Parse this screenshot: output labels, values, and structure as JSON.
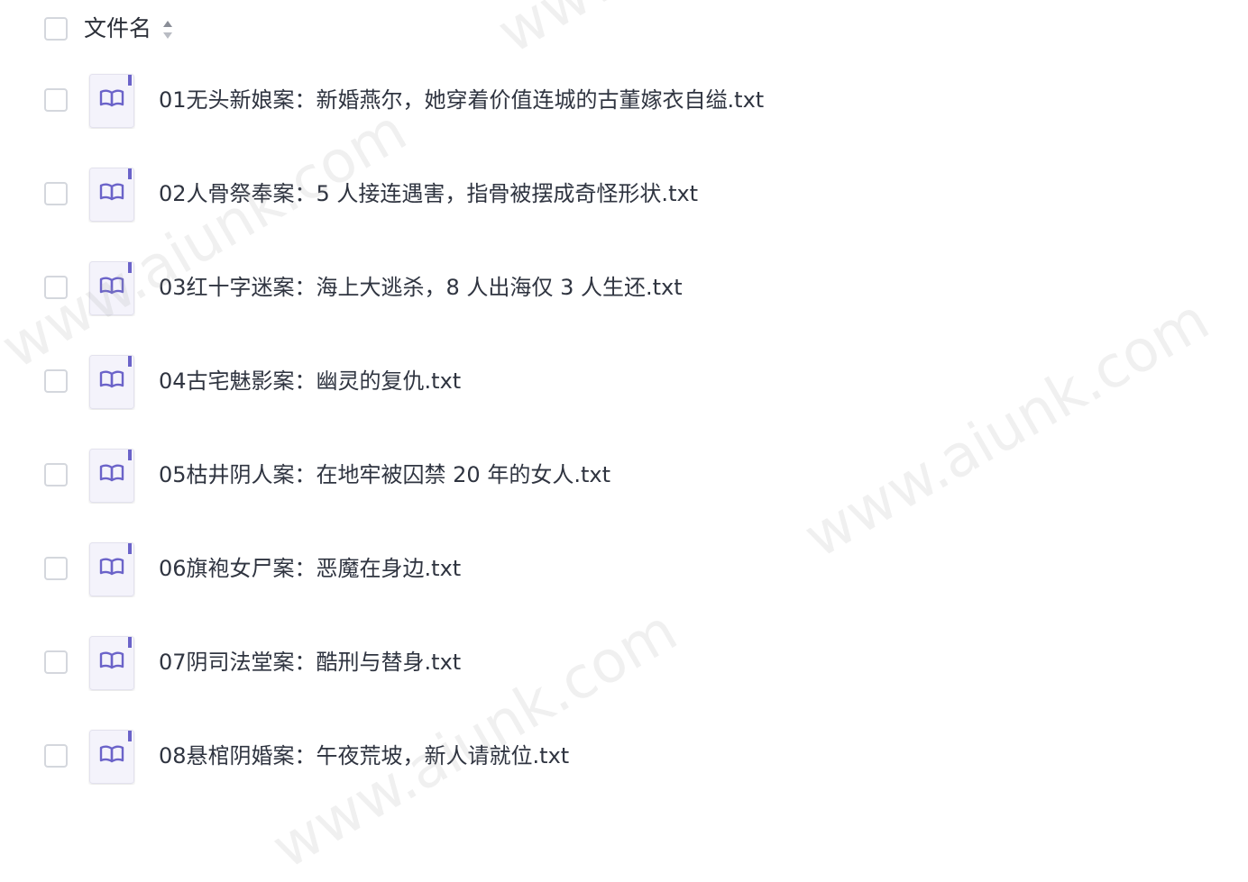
{
  "header": {
    "column_label": "文件名",
    "sort_icon": "sort-up-down-icon"
  },
  "file_icon": "book-icon",
  "files": [
    {
      "name": "01无头新娘案：新婚燕尔，她穿着价值连城的古董嫁衣自缢.txt"
    },
    {
      "name": "02人骨祭奉案：5 人接连遇害，指骨被摆成奇怪形状.txt"
    },
    {
      "name": "03红十字迷案：海上大逃杀，8 人出海仅 3 人生还.txt"
    },
    {
      "name": "04古宅魅影案：幽灵的复仇.txt"
    },
    {
      "name": "05枯井阴人案：在地牢被囚禁 20 年的女人.txt"
    },
    {
      "name": "06旗袍女尸案：恶魔在身边.txt"
    },
    {
      "name": "07阴司法堂案：酷刑与替身.txt"
    },
    {
      "name": "08悬棺阴婚案：午夜荒坡，新人请就位.txt"
    }
  ],
  "watermark": "www.aiunk.com",
  "colors": {
    "icon_accent": "#6b63c9",
    "icon_bg": "#f3f2fb",
    "checkbox_border": "#d4d7dd"
  }
}
